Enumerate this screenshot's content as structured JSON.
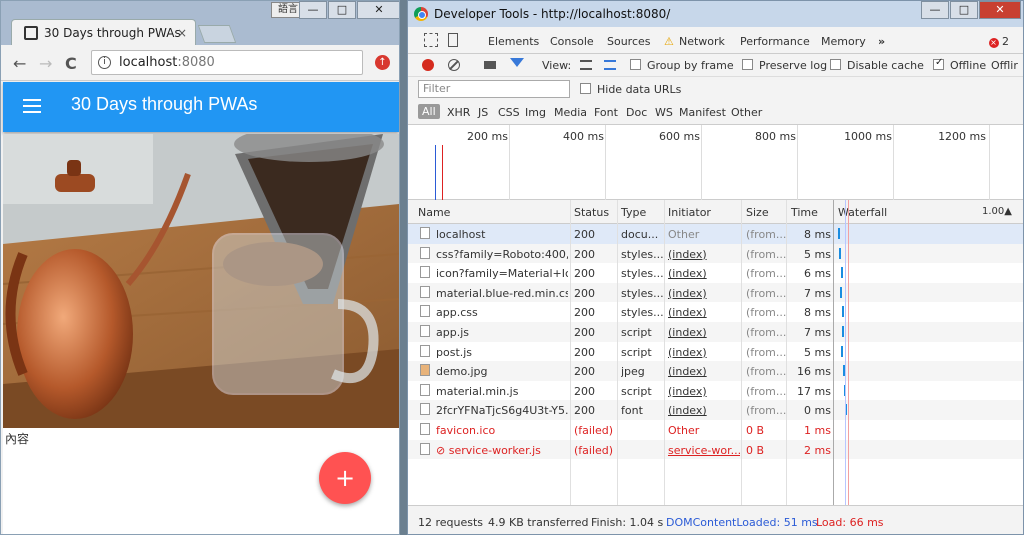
{
  "left": {
    "ime": "語言",
    "tab_title": "30 Days through PWAs",
    "tab_close": "×",
    "window_buttons": [
      "—",
      "□",
      "✕"
    ],
    "nav": {
      "back": "←",
      "forward": "→",
      "reload": "C",
      "info": "i"
    },
    "url_host": "localhost",
    "url_port": ":8080",
    "ext_icon": "↑",
    "app_title": "30 Days through PWAs",
    "content": "內容",
    "fab_label": "+",
    "colors": {
      "appbar": "#2196f3",
      "fab": "#ff5252"
    }
  },
  "devtools": {
    "title": "Developer Tools - http://localhost:8080/",
    "window_buttons": [
      "—",
      "□",
      "✕"
    ],
    "tabs": [
      "Elements",
      "Console",
      "Sources",
      "Network",
      "Performance",
      "Memory",
      "»"
    ],
    "active_tab": "Network",
    "error_count": "2",
    "toolbar": {
      "view_label": "View:",
      "group_by_frame": "Group by frame",
      "preserve_log": "Preserve log",
      "disable_cache": "Disable cache",
      "offline": "Offline",
      "online_cut": "Offlir"
    },
    "filter_placeholder": "Filter",
    "hide_data_urls": "Hide data URLs",
    "types": [
      "All",
      "XHR",
      "JS",
      "CSS",
      "Img",
      "Media",
      "Font",
      "Doc",
      "WS",
      "Manifest",
      "Other"
    ],
    "overview_ticks": [
      "200 ms",
      "400 ms",
      "600 ms",
      "800 ms",
      "1000 ms",
      "1200 ms"
    ],
    "columns": [
      "Name",
      "Status",
      "Type",
      "Initiator",
      "Size",
      "Time",
      "Waterfall"
    ],
    "waterfall_scale": "1.00▲",
    "rows": [
      {
        "name": "localhost",
        "status": "200",
        "type": "docu...",
        "initiator": "Other",
        "size": "(from...",
        "time": "8 ms"
      },
      {
        "name": "css?family=Roboto:400,...",
        "status": "200",
        "type": "styles...",
        "initiator": "(index)",
        "size": "(from...",
        "time": "5 ms"
      },
      {
        "name": "icon?family=Material+Ic...",
        "status": "200",
        "type": "styles...",
        "initiator": "(index)",
        "size": "(from...",
        "time": "6 ms"
      },
      {
        "name": "material.blue-red.min.css",
        "status": "200",
        "type": "styles...",
        "initiator": "(index)",
        "size": "(from...",
        "time": "7 ms"
      },
      {
        "name": "app.css",
        "status": "200",
        "type": "styles...",
        "initiator": "(index)",
        "size": "(from...",
        "time": "8 ms"
      },
      {
        "name": "app.js",
        "status": "200",
        "type": "script",
        "initiator": "(index)",
        "size": "(from...",
        "time": "7 ms"
      },
      {
        "name": "post.js",
        "status": "200",
        "type": "script",
        "initiator": "(index)",
        "size": "(from...",
        "time": "5 ms"
      },
      {
        "name": "demo.jpg",
        "status": "200",
        "type": "jpeg",
        "initiator": "(index)",
        "size": "(from...",
        "time": "16 ms"
      },
      {
        "name": "material.min.js",
        "status": "200",
        "type": "script",
        "initiator": "(index)",
        "size": "(from...",
        "time": "17 ms"
      },
      {
        "name": "2fcrYFNaTjcS6g4U3t-Y5...",
        "status": "200",
        "type": "font",
        "initiator": "(index)",
        "size": "(from...",
        "time": "0 ms"
      },
      {
        "name": "favicon.ico",
        "status": "(failed)",
        "type": "",
        "initiator": "Other",
        "size": "0 B",
        "time": "1 ms"
      },
      {
        "name": "⊘ service-worker.js",
        "status": "(failed)",
        "type": "",
        "initiator": "service-wor...",
        "size": "0 B",
        "time": "2 ms"
      }
    ],
    "status": {
      "requests": "12 requests",
      "transferred": "4.9 KB transferred",
      "finish": "Finish: 1.04 s",
      "dcl": "DOMContentLoaded: 51 ms",
      "load": "Load: 66 ms"
    },
    "colors": {
      "accent": "#3879d9",
      "error": "#d22222",
      "dcl": "#2b5bd6"
    }
  }
}
